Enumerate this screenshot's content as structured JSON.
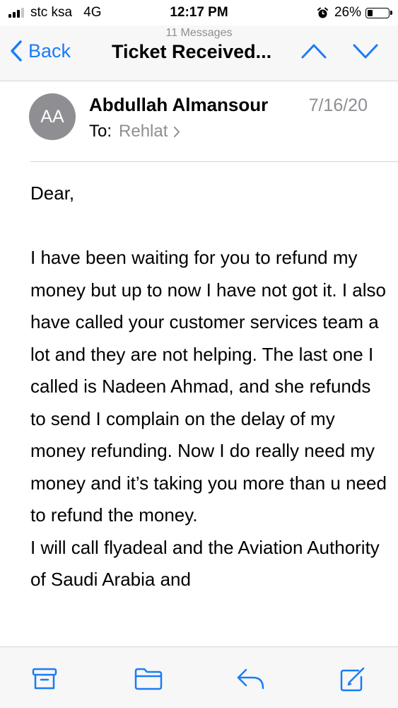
{
  "status_bar": {
    "carrier": "stc ksa",
    "network": "4G",
    "time": "12:17 PM",
    "battery": "26%",
    "battery_level": 0.26
  },
  "nav": {
    "message_count": "11 Messages",
    "back_label": "Back",
    "title": "Ticket Received..."
  },
  "message": {
    "avatar_initials": "AA",
    "sender": "Abdullah Almansour",
    "date": "7/16/20",
    "to_label": "To:",
    "to_recipient": "Rehlat",
    "greeting": "Dear,",
    "paragraph1": "I have been waiting for you to refund my money but up to now I have not got it. I also have called your customer services team a lot and they are not helping. The last one I called is Nadeen Ahmad, and she refunds to send I complain on the delay of my money refunding. Now I do really need my money and it’s taking you more than u need to refund the money.",
    "paragraph2": "I will call flyadeal and the Aviation Authority of Saudi Arabia and"
  },
  "colors": {
    "accent": "#1a7cf5",
    "secondary_text": "#8e8e93",
    "bar_background": "#f7f7f7"
  },
  "toolbar": {
    "icons": [
      "archive-icon",
      "folder-icon",
      "reply-icon",
      "compose-icon"
    ]
  }
}
